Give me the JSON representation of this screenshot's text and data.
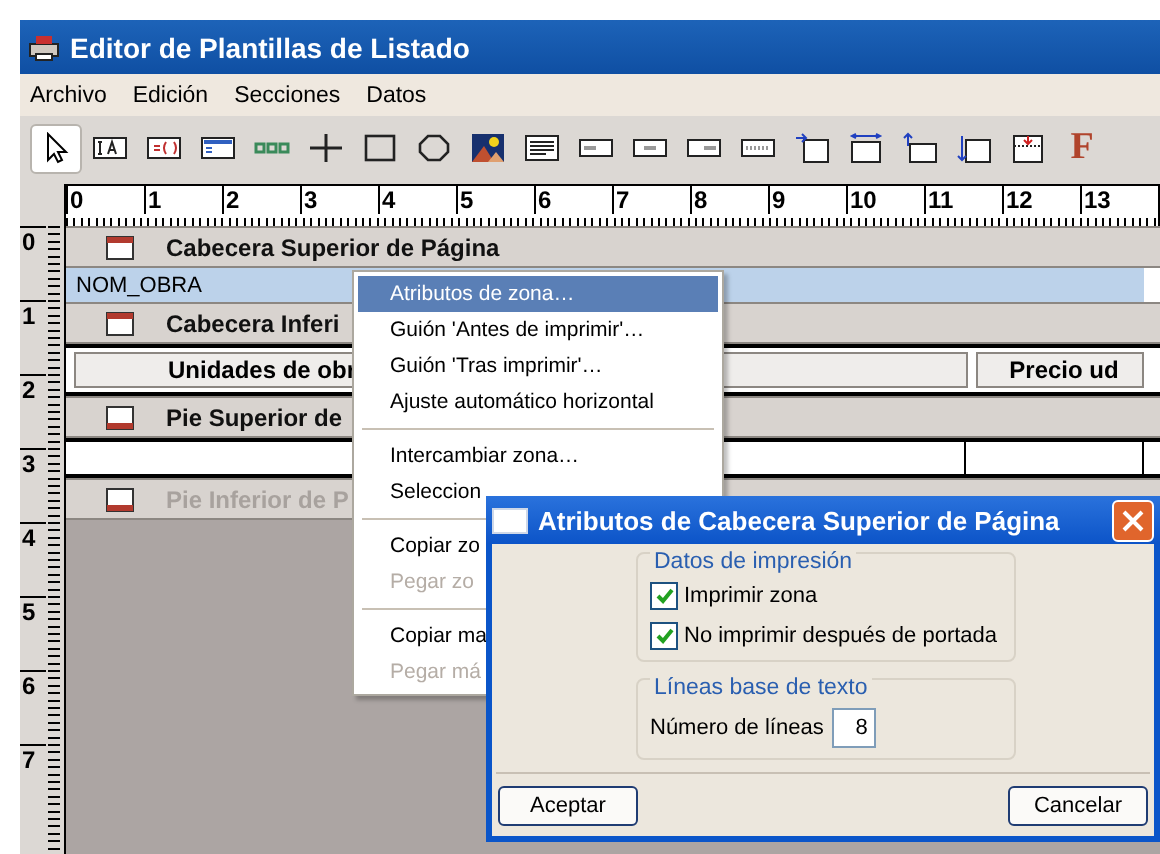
{
  "window": {
    "title": "Editor de Plantillas de Listado"
  },
  "menu_bar": [
    "Archivo",
    "Edición",
    "Secciones",
    "Datos"
  ],
  "toolbar": [
    {
      "kind": "pointer",
      "selected": true
    },
    {
      "kind": "text",
      "selected": false
    },
    {
      "kind": "formula",
      "selected": false
    },
    {
      "kind": "window",
      "selected": false
    },
    {
      "kind": "chain",
      "selected": false
    },
    {
      "kind": "plus",
      "selected": false
    },
    {
      "kind": "square",
      "selected": false
    },
    {
      "kind": "octagon",
      "selected": false
    },
    {
      "kind": "image",
      "selected": false
    },
    {
      "kind": "textblock",
      "selected": false
    },
    {
      "kind": "field-left",
      "selected": false
    },
    {
      "kind": "field-center",
      "selected": false
    },
    {
      "kind": "field-right",
      "selected": false
    },
    {
      "kind": "field-dotted",
      "selected": false
    },
    {
      "kind": "insert-before",
      "selected": false
    },
    {
      "kind": "insert-top",
      "selected": false
    },
    {
      "kind": "insert-after",
      "selected": false
    },
    {
      "kind": "insert-below",
      "selected": false
    },
    {
      "kind": "band-break",
      "selected": false
    },
    {
      "kind": "font",
      "glyph": "F",
      "selected": false
    }
  ],
  "ruler": {
    "horizontal": [
      "0",
      "1",
      "2",
      "3",
      "4",
      "5",
      "6",
      "7",
      "8",
      "9",
      "10",
      "11",
      "12",
      "13"
    ],
    "vertical": [
      "0",
      "1",
      "2",
      "3",
      "4",
      "5",
      "6",
      "7"
    ]
  },
  "sections": [
    {
      "kind": "band",
      "label": "Cabecera Superior de Página",
      "header": true,
      "disabled": false
    },
    {
      "kind": "fields",
      "selected": true,
      "cells": [
        "NOM_OBRA"
      ]
    },
    {
      "kind": "band",
      "label": "Cabecera Inferi",
      "header": true,
      "disabled": false
    },
    {
      "kind": "fields",
      "selected": false,
      "cells": [
        "Unidades de obr",
        "Precio ud"
      ]
    },
    {
      "kind": "band",
      "label": "Pie Superior de",
      "header": false,
      "disabled": false
    },
    {
      "kind": "blank"
    },
    {
      "kind": "band",
      "label": "Pie Inferior de P",
      "header": false,
      "disabled": true
    }
  ],
  "context_menu": {
    "items": [
      {
        "kind": "item",
        "label": "Atributos de zona…",
        "selected": true,
        "disabled": false
      },
      {
        "kind": "item",
        "label": "Guión 'Antes de imprimir'…",
        "selected": false,
        "disabled": false
      },
      {
        "kind": "item",
        "label": "Guión 'Tras imprimir'…",
        "selected": false,
        "disabled": false
      },
      {
        "kind": "item",
        "label": "Ajuste automático horizontal",
        "selected": false,
        "disabled": false
      },
      {
        "kind": "separator"
      },
      {
        "kind": "item",
        "label": "Intercambiar zona…",
        "selected": false,
        "disabled": false
      },
      {
        "kind": "item",
        "label": "Seleccion",
        "selected": false,
        "disabled": false
      },
      {
        "kind": "separator"
      },
      {
        "kind": "item",
        "label": "Copiar zo",
        "selected": false,
        "disabled": false
      },
      {
        "kind": "item",
        "label": "Pegar zo",
        "selected": false,
        "disabled": true
      },
      {
        "kind": "separator"
      },
      {
        "kind": "item",
        "label": "Copiar ma",
        "selected": false,
        "disabled": false
      },
      {
        "kind": "item",
        "label": "Pegar má",
        "selected": false,
        "disabled": true
      }
    ]
  },
  "dialog": {
    "title": "Atributos de Cabecera Superior de Página",
    "groups": [
      {
        "kind": "checks",
        "title": "Datos de impresión",
        "options": [
          {
            "label": "Imprimir zona",
            "checked": true
          },
          {
            "label": "No imprimir después de portada",
            "checked": true
          }
        ]
      },
      {
        "kind": "number",
        "title": "Líneas base de texto",
        "label": "Número de líneas",
        "value": "8"
      }
    ],
    "buttons": [
      "Aceptar",
      "Cancelar"
    ]
  }
}
